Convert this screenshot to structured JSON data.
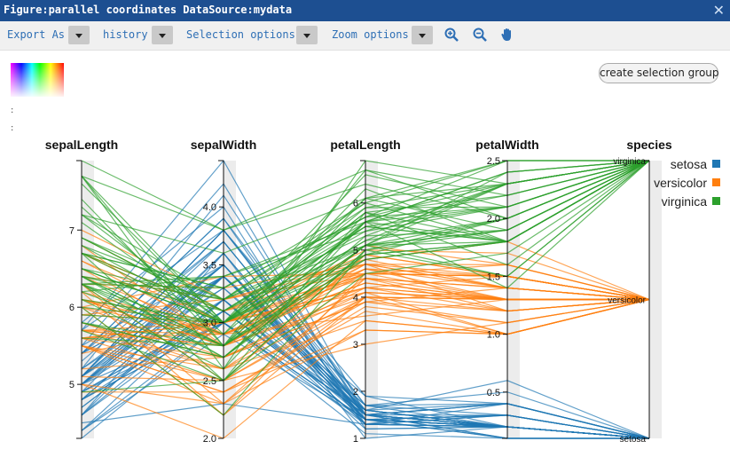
{
  "window": {
    "title": "Figure:parallel coordinates DataSource:mydata",
    "close": "✕"
  },
  "toolbar": {
    "export_as": "Export As",
    "history": "history",
    "selection_options": "Selection options",
    "zoom_options": "Zoom options",
    "icons": [
      "zoom-in-icon",
      "zoom-out-icon",
      "pan-hand-icon"
    ]
  },
  "colormap_dots": [
    ":",
    ":"
  ],
  "selection_button": "create selection group",
  "chart_data": {
    "type": "parallel-coordinates",
    "axes": [
      {
        "name": "sepalLength",
        "range": [
          4.3,
          7.9
        ],
        "ticks": [
          5,
          6,
          7
        ]
      },
      {
        "name": "sepalWidth",
        "range": [
          2.0,
          4.4
        ],
        "ticks": [
          2.0,
          2.5,
          3.0,
          3.5,
          4.0
        ]
      },
      {
        "name": "petalLength",
        "range": [
          1,
          6.9
        ],
        "ticks": [
          1,
          2,
          3,
          4,
          5,
          6
        ]
      },
      {
        "name": "petalWidth",
        "range": [
          0.1,
          2.5
        ],
        "ticks": [
          0.5,
          1.0,
          1.5,
          2.0,
          2.5
        ]
      },
      {
        "name": "species",
        "categories": [
          "setosa",
          "versicolor",
          "virginica"
        ]
      }
    ],
    "legend": [
      {
        "name": "setosa",
        "color": "#1f77b4"
      },
      {
        "name": "versicolor",
        "color": "#ff7f0e"
      },
      {
        "name": "virginica",
        "color": "#2ca02c"
      }
    ],
    "legend_position": "top-right",
    "rows": [
      [
        5.1,
        3.5,
        1.4,
        0.2,
        0
      ],
      [
        4.9,
        3.0,
        1.4,
        0.2,
        0
      ],
      [
        4.7,
        3.2,
        1.3,
        0.2,
        0
      ],
      [
        4.6,
        3.1,
        1.5,
        0.2,
        0
      ],
      [
        5.0,
        3.6,
        1.4,
        0.2,
        0
      ],
      [
        5.4,
        3.9,
        1.7,
        0.4,
        0
      ],
      [
        4.6,
        3.4,
        1.4,
        0.3,
        0
      ],
      [
        5.0,
        3.4,
        1.5,
        0.2,
        0
      ],
      [
        4.4,
        2.9,
        1.4,
        0.2,
        0
      ],
      [
        4.9,
        3.1,
        1.5,
        0.1,
        0
      ],
      [
        5.4,
        3.7,
        1.5,
        0.2,
        0
      ],
      [
        4.8,
        3.4,
        1.6,
        0.2,
        0
      ],
      [
        4.8,
        3.0,
        1.4,
        0.1,
        0
      ],
      [
        4.3,
        3.0,
        1.1,
        0.1,
        0
      ],
      [
        5.8,
        4.0,
        1.2,
        0.2,
        0
      ],
      [
        5.7,
        4.4,
        1.5,
        0.4,
        0
      ],
      [
        5.4,
        3.9,
        1.3,
        0.4,
        0
      ],
      [
        5.1,
        3.5,
        1.4,
        0.3,
        0
      ],
      [
        5.7,
        3.8,
        1.7,
        0.3,
        0
      ],
      [
        5.1,
        3.8,
        1.5,
        0.3,
        0
      ],
      [
        5.4,
        3.4,
        1.7,
        0.2,
        0
      ],
      [
        5.1,
        3.7,
        1.5,
        0.4,
        0
      ],
      [
        4.6,
        3.6,
        1.0,
        0.2,
        0
      ],
      [
        5.1,
        3.3,
        1.7,
        0.5,
        0
      ],
      [
        4.8,
        3.4,
        1.9,
        0.2,
        0
      ],
      [
        5.0,
        3.0,
        1.6,
        0.2,
        0
      ],
      [
        5.0,
        3.4,
        1.6,
        0.4,
        0
      ],
      [
        5.2,
        3.5,
        1.5,
        0.2,
        0
      ],
      [
        5.2,
        3.4,
        1.4,
        0.2,
        0
      ],
      [
        4.7,
        3.2,
        1.6,
        0.2,
        0
      ],
      [
        4.8,
        3.1,
        1.6,
        0.2,
        0
      ],
      [
        5.4,
        3.4,
        1.5,
        0.4,
        0
      ],
      [
        5.2,
        4.1,
        1.5,
        0.1,
        0
      ],
      [
        5.5,
        4.2,
        1.4,
        0.2,
        0
      ],
      [
        4.9,
        3.1,
        1.5,
        0.2,
        0
      ],
      [
        5.0,
        3.2,
        1.2,
        0.2,
        0
      ],
      [
        5.5,
        3.5,
        1.3,
        0.2,
        0
      ],
      [
        4.9,
        3.6,
        1.4,
        0.1,
        0
      ],
      [
        4.4,
        3.0,
        1.3,
        0.2,
        0
      ],
      [
        5.1,
        3.4,
        1.5,
        0.2,
        0
      ],
      [
        5.0,
        3.5,
        1.3,
        0.3,
        0
      ],
      [
        4.5,
        2.3,
        1.3,
        0.3,
        0
      ],
      [
        4.4,
        3.2,
        1.3,
        0.2,
        0
      ],
      [
        5.0,
        3.5,
        1.6,
        0.6,
        0
      ],
      [
        5.1,
        3.8,
        1.9,
        0.4,
        0
      ],
      [
        4.8,
        3.0,
        1.4,
        0.3,
        0
      ],
      [
        5.1,
        3.8,
        1.6,
        0.2,
        0
      ],
      [
        4.6,
        3.2,
        1.4,
        0.2,
        0
      ],
      [
        5.3,
        3.7,
        1.5,
        0.2,
        0
      ],
      [
        5.0,
        3.3,
        1.4,
        0.2,
        0
      ],
      [
        7.0,
        3.2,
        4.7,
        1.4,
        1
      ],
      [
        6.4,
        3.2,
        4.5,
        1.5,
        1
      ],
      [
        6.9,
        3.1,
        4.9,
        1.5,
        1
      ],
      [
        5.5,
        2.3,
        4.0,
        1.3,
        1
      ],
      [
        6.5,
        2.8,
        4.6,
        1.5,
        1
      ],
      [
        5.7,
        2.8,
        4.5,
        1.3,
        1
      ],
      [
        6.3,
        3.3,
        4.7,
        1.6,
        1
      ],
      [
        4.9,
        2.4,
        3.3,
        1.0,
        1
      ],
      [
        6.6,
        2.9,
        4.6,
        1.3,
        1
      ],
      [
        5.2,
        2.7,
        3.9,
        1.4,
        1
      ],
      [
        5.0,
        2.0,
        3.5,
        1.0,
        1
      ],
      [
        5.9,
        3.0,
        4.2,
        1.5,
        1
      ],
      [
        6.0,
        2.2,
        4.0,
        1.0,
        1
      ],
      [
        6.1,
        2.9,
        4.7,
        1.4,
        1
      ],
      [
        5.6,
        2.9,
        3.6,
        1.3,
        1
      ],
      [
        6.7,
        3.1,
        4.4,
        1.4,
        1
      ],
      [
        5.6,
        3.0,
        4.5,
        1.5,
        1
      ],
      [
        5.8,
        2.7,
        4.1,
        1.0,
        1
      ],
      [
        6.2,
        2.2,
        4.5,
        1.5,
        1
      ],
      [
        5.6,
        2.5,
        3.9,
        1.1,
        1
      ],
      [
        5.9,
        3.2,
        4.8,
        1.8,
        1
      ],
      [
        6.1,
        2.8,
        4.0,
        1.3,
        1
      ],
      [
        6.3,
        2.5,
        4.9,
        1.5,
        1
      ],
      [
        6.1,
        2.8,
        4.7,
        1.2,
        1
      ],
      [
        6.4,
        2.9,
        4.3,
        1.3,
        1
      ],
      [
        6.6,
        3.0,
        4.4,
        1.4,
        1
      ],
      [
        6.8,
        2.8,
        4.8,
        1.4,
        1
      ],
      [
        6.7,
        3.0,
        5.0,
        1.7,
        1
      ],
      [
        6.0,
        2.9,
        4.5,
        1.5,
        1
      ],
      [
        5.7,
        2.6,
        3.5,
        1.0,
        1
      ],
      [
        5.5,
        2.4,
        3.8,
        1.1,
        1
      ],
      [
        5.5,
        2.4,
        3.7,
        1.0,
        1
      ],
      [
        5.8,
        2.7,
        3.9,
        1.2,
        1
      ],
      [
        6.0,
        2.7,
        5.1,
        1.6,
        1
      ],
      [
        5.4,
        3.0,
        4.5,
        1.5,
        1
      ],
      [
        6.0,
        3.4,
        4.5,
        1.6,
        1
      ],
      [
        6.7,
        3.1,
        4.7,
        1.5,
        1
      ],
      [
        6.3,
        2.3,
        4.4,
        1.3,
        1
      ],
      [
        5.6,
        3.0,
        4.1,
        1.3,
        1
      ],
      [
        5.5,
        2.5,
        4.0,
        1.3,
        1
      ],
      [
        5.5,
        2.6,
        4.4,
        1.2,
        1
      ],
      [
        6.1,
        3.0,
        4.6,
        1.4,
        1
      ],
      [
        5.8,
        2.6,
        4.0,
        1.2,
        1
      ],
      [
        5.0,
        2.3,
        3.3,
        1.0,
        1
      ],
      [
        5.6,
        2.7,
        4.2,
        1.3,
        1
      ],
      [
        5.7,
        3.0,
        4.2,
        1.2,
        1
      ],
      [
        5.7,
        2.9,
        4.2,
        1.3,
        1
      ],
      [
        6.2,
        2.9,
        4.3,
        1.3,
        1
      ],
      [
        5.1,
        2.5,
        3.0,
        1.1,
        1
      ],
      [
        5.7,
        2.8,
        4.1,
        1.3,
        1
      ],
      [
        6.3,
        3.3,
        6.0,
        2.5,
        2
      ],
      [
        5.8,
        2.7,
        5.1,
        1.9,
        2
      ],
      [
        7.1,
        3.0,
        5.9,
        2.1,
        2
      ],
      [
        6.3,
        2.9,
        5.6,
        1.8,
        2
      ],
      [
        6.5,
        3.0,
        5.8,
        2.2,
        2
      ],
      [
        7.6,
        3.0,
        6.6,
        2.1,
        2
      ],
      [
        4.9,
        2.5,
        4.5,
        1.7,
        2
      ],
      [
        7.3,
        2.9,
        6.3,
        1.8,
        2
      ],
      [
        6.7,
        2.5,
        5.8,
        1.8,
        2
      ],
      [
        7.2,
        3.6,
        6.1,
        2.5,
        2
      ],
      [
        6.5,
        3.2,
        5.1,
        2.0,
        2
      ],
      [
        6.4,
        2.7,
        5.3,
        1.9,
        2
      ],
      [
        6.8,
        3.0,
        5.5,
        2.1,
        2
      ],
      [
        5.7,
        2.5,
        5.0,
        2.0,
        2
      ],
      [
        5.8,
        2.8,
        5.1,
        2.4,
        2
      ],
      [
        6.4,
        3.2,
        5.3,
        2.3,
        2
      ],
      [
        6.5,
        3.0,
        5.5,
        1.8,
        2
      ],
      [
        7.7,
        3.8,
        6.7,
        2.2,
        2
      ],
      [
        7.7,
        2.6,
        6.9,
        2.3,
        2
      ],
      [
        6.0,
        2.2,
        5.0,
        1.5,
        2
      ],
      [
        6.9,
        3.2,
        5.7,
        2.3,
        2
      ],
      [
        5.6,
        2.8,
        4.9,
        2.0,
        2
      ],
      [
        7.7,
        2.8,
        6.7,
        2.0,
        2
      ],
      [
        6.3,
        2.7,
        4.9,
        1.8,
        2
      ],
      [
        6.7,
        3.3,
        5.7,
        2.1,
        2
      ],
      [
        7.2,
        3.2,
        6.0,
        1.8,
        2
      ],
      [
        6.2,
        2.8,
        4.8,
        1.8,
        2
      ],
      [
        6.1,
        3.0,
        4.9,
        1.8,
        2
      ],
      [
        6.4,
        2.8,
        5.6,
        2.1,
        2
      ],
      [
        7.2,
        3.0,
        5.8,
        1.6,
        2
      ],
      [
        7.4,
        2.8,
        6.1,
        1.9,
        2
      ],
      [
        7.9,
        3.8,
        6.4,
        2.0,
        2
      ],
      [
        6.4,
        2.8,
        5.6,
        2.2,
        2
      ],
      [
        6.3,
        2.8,
        5.1,
        1.5,
        2
      ],
      [
        6.1,
        2.6,
        5.6,
        1.4,
        2
      ],
      [
        7.7,
        3.0,
        6.1,
        2.3,
        2
      ],
      [
        6.3,
        3.4,
        5.6,
        2.4,
        2
      ],
      [
        6.4,
        3.1,
        5.5,
        1.8,
        2
      ],
      [
        6.0,
        3.0,
        4.8,
        1.8,
        2
      ],
      [
        6.9,
        3.1,
        5.4,
        2.1,
        2
      ],
      [
        6.7,
        3.1,
        5.6,
        2.4,
        2
      ],
      [
        6.9,
        3.1,
        5.1,
        2.3,
        2
      ],
      [
        5.8,
        2.7,
        5.1,
        1.9,
        2
      ],
      [
        6.8,
        3.2,
        5.9,
        2.3,
        2
      ],
      [
        6.7,
        3.3,
        5.7,
        2.5,
        2
      ],
      [
        6.7,
        3.0,
        5.2,
        2.3,
        2
      ],
      [
        6.3,
        2.5,
        5.0,
        1.9,
        2
      ],
      [
        6.5,
        3.0,
        5.2,
        2.0,
        2
      ],
      [
        6.2,
        3.4,
        5.4,
        2.3,
        2
      ],
      [
        5.9,
        3.0,
        5.1,
        1.8,
        2
      ]
    ]
  }
}
